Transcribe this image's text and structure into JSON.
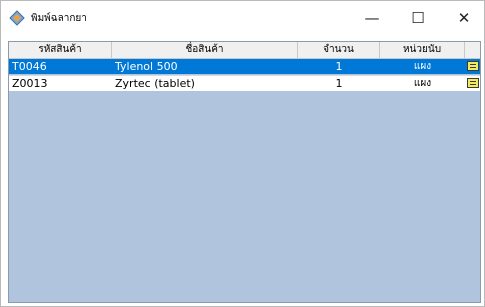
{
  "window": {
    "title": "พิมพ์ฉลากยา",
    "minimize_glyph": "—",
    "maximize_glyph": "☐",
    "close_glyph": "✕"
  },
  "table": {
    "columns": [
      "รหัสสินค้า",
      "ชื่อสินค้า",
      "จำนวน",
      "หน่วยนับ",
      ""
    ],
    "rows": [
      {
        "code": "T0046",
        "name": "Tylenol 500",
        "qty": "1",
        "unit": "แผง",
        "note_icon": "note-icon",
        "selected": true
      },
      {
        "code": "Z0013",
        "name": "Zyrtec (tablet)",
        "qty": "1",
        "unit": "แผง",
        "note_icon": "note-icon",
        "selected": false
      }
    ]
  },
  "colors": {
    "selection": "#0078d7",
    "grid_background": "#b0c4de",
    "note_icon": "#f2ea5a"
  }
}
